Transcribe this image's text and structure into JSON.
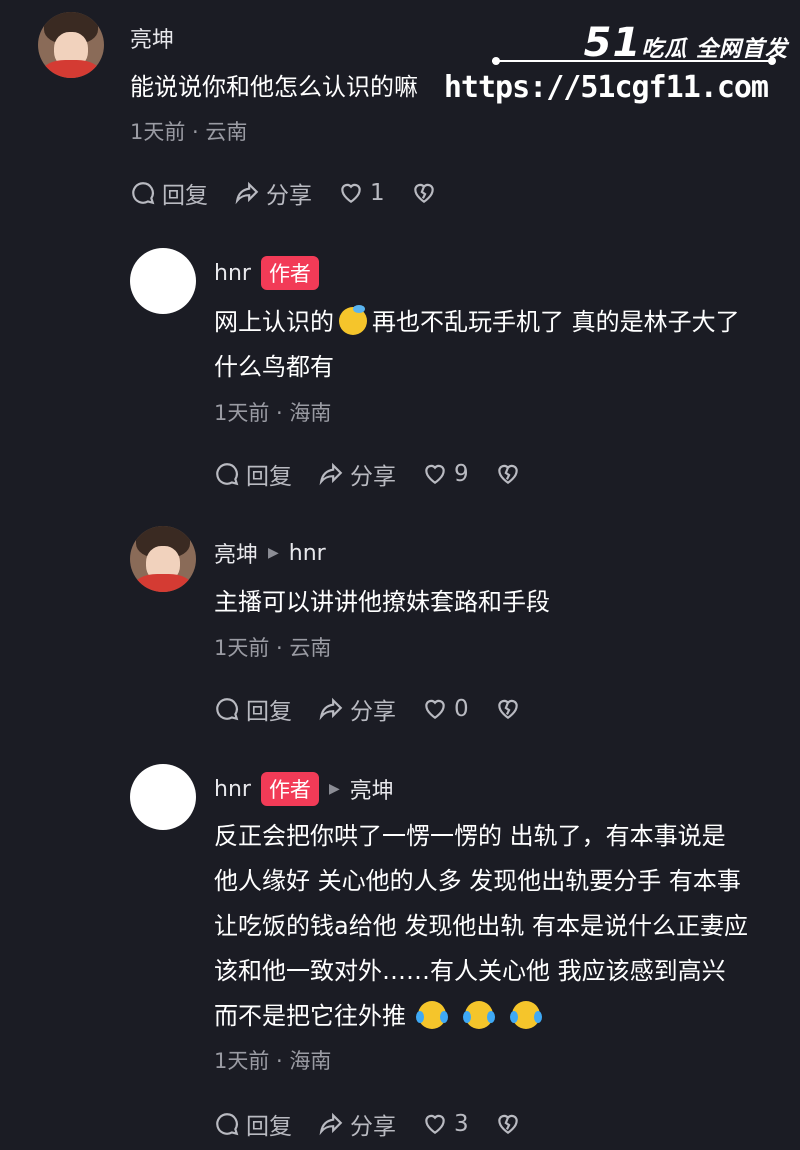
{
  "watermark": {
    "brand_num": "51",
    "brand_tag": "吃瓜 全网首发",
    "url": "https://51cgf11.com"
  },
  "comments": [
    {
      "author": "亮坤",
      "lines": [
        "能说说你和他怎么认识的嘛"
      ],
      "meta": "1天前 · 云南",
      "reply_label": "回复",
      "share_label": "分享",
      "likes": "1"
    },
    {
      "author": "hnr",
      "badge": "作者",
      "lines": [
        "网上认识的",
        "再也不乱玩手机了 真的是林子大了",
        "什么鸟都有"
      ],
      "meta": "1天前 · 海南",
      "reply_label": "回复",
      "share_label": "分享",
      "likes": "9"
    },
    {
      "author": "亮坤",
      "reply_to": "hnr",
      "lines": [
        "主播可以讲讲他撩妹套路和手段"
      ],
      "meta": "1天前 · 云南",
      "reply_label": "回复",
      "share_label": "分享",
      "likes": "0"
    },
    {
      "author": "hnr",
      "badge": "作者",
      "reply_to": "亮坤",
      "lines": [
        "反正会把你哄了一愣一愣的 出轨了，有本事说是",
        "他人缘好 关心他的人多 发现他出轨要分手  有本事",
        "让吃饭的钱a给他 发现他出轨 有本是说什么正妻应",
        "该和他一致对外……有人关心他 我应该感到高兴",
        "而不是把它往外推"
      ],
      "meta": "1天前 · 海南",
      "reply_label": "回复",
      "share_label": "分享",
      "likes": "3"
    }
  ]
}
